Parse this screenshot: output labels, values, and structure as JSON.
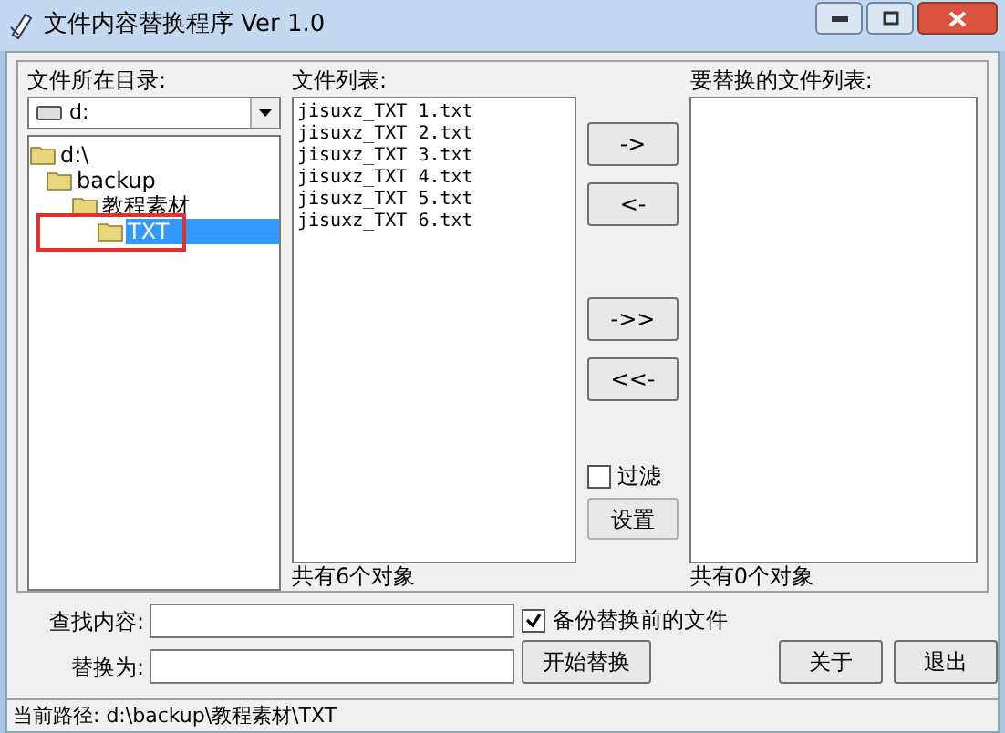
{
  "window": {
    "title": "文件内容替换程序 Ver 1.0"
  },
  "directory": {
    "label": "文件所在目录:",
    "drive": "d:",
    "tree": [
      {
        "label": "d:\\",
        "selected": false,
        "children": [
          {
            "label": "backup",
            "selected": false,
            "children": [
              {
                "label": "教程素材",
                "selected": false,
                "children": [
                  {
                    "label": "TXT",
                    "selected": true,
                    "highlighted": true
                  }
                ]
              }
            ]
          }
        ]
      }
    ]
  },
  "file_list": {
    "label": "文件列表:",
    "items": [
      "jisuxz_TXT 1.txt",
      "jisuxz_TXT 2.txt",
      "jisuxz_TXT 3.txt",
      "jisuxz_TXT 4.txt",
      "jisuxz_TXT 5.txt",
      "jisuxz_TXT 6.txt"
    ],
    "count": "共有6个对象"
  },
  "move_buttons": [
    [
      "->",
      "<-"
    ],
    [
      "->>",
      "<<-"
    ]
  ],
  "filter": {
    "label": "过滤",
    "checked": false
  },
  "settings_button": {
    "label": "设置",
    "disabled": true
  },
  "target_list": {
    "label": "要替换的文件列表:",
    "count": "共有0个对象"
  },
  "find": {
    "label": "查找内容:"
  },
  "replace": {
    "label": "替换为:"
  },
  "backup": {
    "label": "备份替换前的文件",
    "checked": true
  },
  "buttons": [
    "开始替换",
    "关于",
    "退出"
  ],
  "status_bar": "当前路径: d:\\backup\\教程素材\\TXT"
}
